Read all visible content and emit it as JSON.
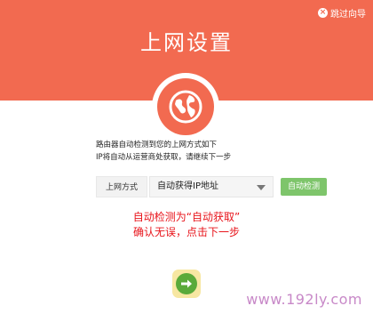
{
  "header": {
    "background": "#f26a50",
    "title": "上网设置",
    "skip_label": "跳过向导",
    "skip_icon_glyph": "×"
  },
  "globe_icon": "globe-icon",
  "info": {
    "line1": "路由器自动检测到您的上网方式如下",
    "line2": "IP将自动从运营商处获取，请继续下一步"
  },
  "connection": {
    "label": "上网方式",
    "selected": "自动获得IP地址",
    "detect_label": "自动检测",
    "detect_color": "#7ec56b"
  },
  "annotation": {
    "line1": "自动检测为“自动获取”",
    "line2": "确认无误，点击下一步",
    "color": "#e8141b"
  },
  "next_button": {
    "icon": "arrow-right-icon",
    "color": "#5aaa3a"
  },
  "watermark": "www.192ly.com"
}
